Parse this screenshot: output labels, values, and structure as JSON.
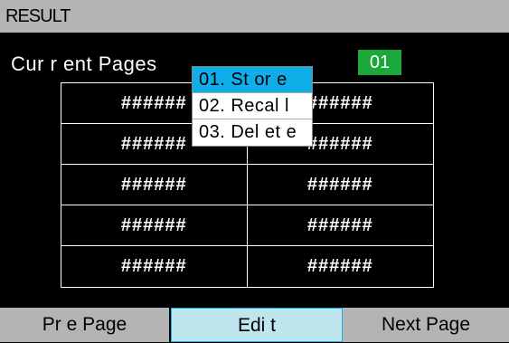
{
  "title": "RESULT",
  "current_pages_label": "Cur r ent Pages",
  "page_number": "01",
  "table": {
    "rows": [
      [
        "######",
        "######"
      ],
      [
        "######",
        "######"
      ],
      [
        "######",
        "######"
      ],
      [
        "######",
        "######"
      ],
      [
        "######",
        "######"
      ]
    ]
  },
  "menu": {
    "items": [
      "01. St or e",
      "02. Recal l",
      "03. Del et e"
    ],
    "selected_index": 0
  },
  "softkeys": [
    "Pr e Page",
    "Edi t",
    "Next Page"
  ],
  "colors": {
    "title_bar": "#b4b4b4",
    "badge": "#1aa83a",
    "selected": "#10aee8"
  }
}
